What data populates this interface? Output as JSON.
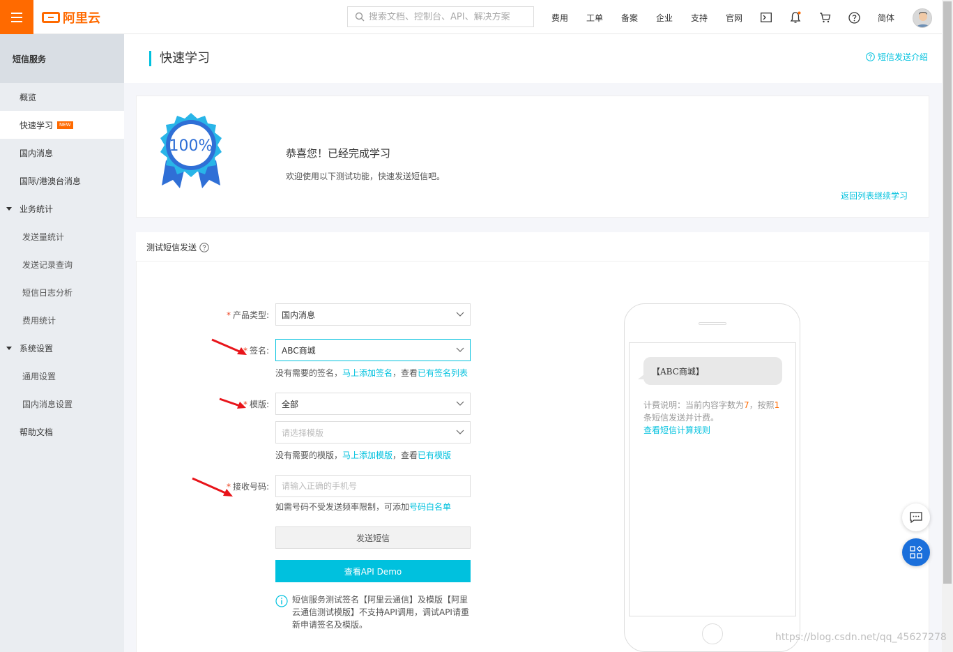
{
  "header": {
    "logo_text": "阿里云",
    "search_placeholder": "搜索文档、控制台、API、解决方案",
    "nav": [
      "费用",
      "工单",
      "备案",
      "企业",
      "支持",
      "官网"
    ],
    "lang": "简体"
  },
  "sidebar": {
    "title": "短信服务",
    "items": [
      {
        "label": "概览"
      },
      {
        "label": "快速学习",
        "badge": "NEW"
      },
      {
        "label": "国内消息"
      },
      {
        "label": "国际/港澳台消息"
      },
      {
        "label": "业务统计"
      },
      {
        "label": "发送量统计"
      },
      {
        "label": "发送记录查询"
      },
      {
        "label": "短信日志分析"
      },
      {
        "label": "费用统计"
      },
      {
        "label": "系统设置"
      },
      {
        "label": "通用设置"
      },
      {
        "label": "国内消息设置"
      },
      {
        "label": "帮助文档"
      }
    ]
  },
  "page": {
    "title": "快速学习",
    "help_link": "短信发送介绍"
  },
  "congrats": {
    "badge_text": "100%",
    "title": "恭喜您！已经完成学习",
    "subtitle": "欢迎使用以下测试功能，快速发送短信吧。",
    "back_link": "返回列表继续学习"
  },
  "test_form": {
    "section_title": "测试短信发送",
    "product_label": "产品类型:",
    "product_value": "国内消息",
    "sign_label": "签名:",
    "sign_value": "ABC商城",
    "sign_hint_prefix": "没有需要的签名，",
    "sign_hint_link1": "马上添加签名",
    "sign_hint_mid": "，查看",
    "sign_hint_link2": "已有签名列表",
    "template_label": "模版:",
    "template_value": "全部",
    "template_placeholder": "请选择模版",
    "template_hint_prefix": "没有需要的模版，",
    "template_hint_link1": "马上添加模版",
    "template_hint_mid": "，查看",
    "template_hint_link2": "已有模版",
    "phone_label": "接收号码:",
    "phone_placeholder": "请输入正确的手机号",
    "phone_hint_prefix": "如需号码不受发送频率限制，可添加",
    "phone_hint_link": "号码白名单",
    "send_button": "发送短信",
    "demo_button": "查看API Demo",
    "notice": "短信服务测试签名【阿里云通信】及模版【阿里云通信测试模版】不支持API调用，调试API请重新申请签名及模版。"
  },
  "phone_preview": {
    "message": "【ABC商城】",
    "bill_prefix": "计费说明：当前内容字数为",
    "char_count": "7",
    "bill_mid": "，按照",
    "sms_count": "1",
    "bill_suffix": "条短信发送并计费。",
    "bill_link": "查看短信计算规则"
  },
  "watermark": "https://blog.csdn.net/qq_45627278",
  "colors": {
    "brand": "#ff6a00",
    "accent": "#00c1de",
    "required": "#e42"
  }
}
